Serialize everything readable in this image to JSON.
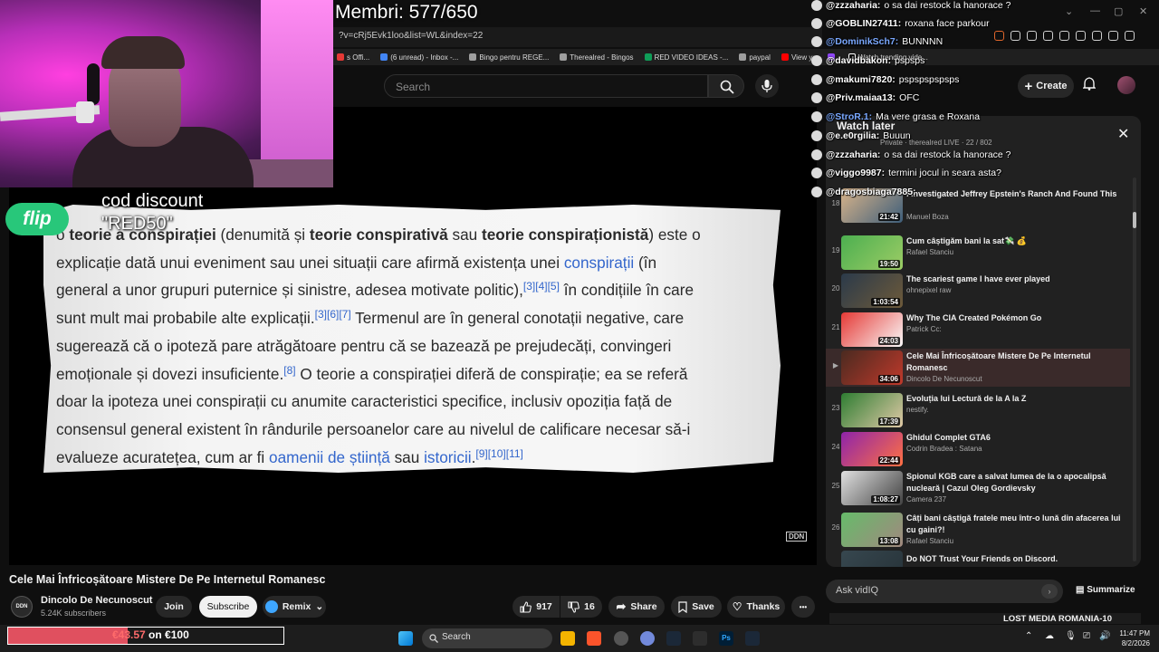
{
  "stream": {
    "membri": "Membri: 577/650",
    "promo": "cod discount\n\"RED50\"",
    "flip": "flip",
    "hype_current": "€43.57",
    "hype_goal": "on €100",
    "hype_fraction": 0.4357
  },
  "browser": {
    "url": "?v=cRj5Evk1loo&list=WL&index=22",
    "bookmarks": [
      "s Offi...",
      "(6 unread) - Inbox -...",
      "Bingo pentru REGE...",
      "Therealred - Bingos",
      "RED VIDEO IDEAS -...",
      "paypal",
      "View yo",
      "",
      "Watch trending vide..."
    ]
  },
  "youtube": {
    "search_placeholder": "Search",
    "create_label": "Create",
    "video_title": "Cele Mai Înfricoșătoare Mistere De Pe Internetul Romanesc",
    "channel_name": "Dincolo De Necunoscut",
    "channel_subs": "5.24K subscribers",
    "channel_avatar": "DDN",
    "join_label": "Join",
    "subscribe_label": "Subscribe",
    "remix_label": "Remix",
    "likes": "917",
    "dislikes": "16",
    "share_label": "Share",
    "save_label": "Save",
    "thanks_label": "Thanks",
    "more_label": "•••",
    "watermark": "DDN"
  },
  "wiki": {
    "l1_a": "o ",
    "l1_b": "teorie a conspirației",
    "l1_c": " (denumită și ",
    "l1_d": "teorie conspirativă",
    "l1_e": " sau ",
    "l1_f": "teorie conspiraționistă",
    "l1_g": ") este o",
    "l2_a": "explicație dată unui eveniment sau unei situații care afirmă existența unei ",
    "l2_b": "conspirații",
    "l2_c": " (în",
    "l3_a": "general a unor grupuri puternice și sinistre, adesea motivate politic),",
    "l3_sup": "[3][4][5]",
    "l3_b": " în condițiile în care",
    "l4_a": "sunt mult mai probabile alte explicații.",
    "l4_sup": "[3][6][7]",
    "l4_b": " Termenul are în general conotații negative, care",
    "l5": "sugerează că o ipoteză pare atrăgătoare pentru că se bazează pe prejudecăți, convingeri",
    "l6_a": "emoționale și dovezi insuficiente.",
    "l6_sup": "[8]",
    "l6_b": " O teorie a conspirației diferă de conspirație; ea se referă",
    "l7": "doar la ipoteza unei conspirații cu anumite caracteristici specifice, inclusiv opoziția față de",
    "l8": "consensul general existent în rândurile persoanelor care au nivelul de calificare necesar să-i",
    "l9_a": "evalueze acuratețea, cum ar fi ",
    "l9_b": "oamenii de știință",
    "l9_c": " sau ",
    "l9_d": "istoricii",
    "l9_e": ".",
    "l9_sup": "[9][10][11]"
  },
  "chat": [
    {
      "user": "@zzzaharia:",
      "msg": "o sa dai restock la hanorace ?",
      "hl": false
    },
    {
      "user": "@GOBLIN27411:",
      "msg": "roxana face parkour",
      "hl": false
    },
    {
      "user": "@DominikSch7:",
      "msg": "BUNNNN",
      "hl": true
    },
    {
      "user": "@davidbakon:",
      "msg": "pspsps",
      "hl": false
    },
    {
      "user": "@makumi7820:",
      "msg": "pspspspspsps",
      "hl": false
    },
    {
      "user": "@Priv.maiaa13:",
      "msg": "OFC",
      "hl": false
    },
    {
      "user": "@StroR.1:",
      "msg": "Ma vere grasa e Roxana",
      "hl": true
    },
    {
      "user": "@e.e0rgilia:",
      "msg": "Buuun",
      "hl": false
    },
    {
      "user": "@zzzaharia:",
      "msg": "o sa dai restock la hanorace ?",
      "hl": false
    },
    {
      "user": "@viggo9987:",
      "msg": "termini jocul in seara asta?",
      "hl": false
    },
    {
      "user": "@dragosbiaga7885:",
      "msg": "",
      "hl": false
    }
  ],
  "watch_later": {
    "title": "Watch later",
    "subtitle": "Private · therealred LIVE · 22 / 802",
    "close": "✕",
    "items": [
      {
        "num": "18",
        "title": "I Investigated Jeffrey Epstein's Ranch And Found This",
        "channel": "Manuel Boza",
        "duration": "21:42",
        "active": false,
        "c1": "#d9b48a",
        "c2": "#3e5e7a"
      },
      {
        "num": "19",
        "title": "Cum câștigăm bani la sat💸 💰",
        "channel": "Rafael Stanciu",
        "duration": "19:50",
        "active": false,
        "c1": "#4caf50",
        "c2": "#9ccc65"
      },
      {
        "num": "20",
        "title": "The scariest game I have ever played",
        "channel": "ohnepixel raw",
        "duration": "1:03:54",
        "active": false,
        "c1": "#2b3a4a",
        "c2": "#6d5a3a"
      },
      {
        "num": "21",
        "title": "Why The CIA Created Pokémon Go",
        "channel": "Patrick Cc:",
        "duration": "24:03",
        "active": false,
        "c1": "#e53935",
        "c2": "#fafafa"
      },
      {
        "num": "▶",
        "title": "Cele Mai Înfricoșătoare Mistere De Pe Internetul Romanesc",
        "channel": "Dincolo De Necunoscut",
        "duration": "34:06",
        "active": true,
        "c1": "#4a2a20",
        "c2": "#c0392b"
      },
      {
        "num": "23",
        "title": "Evoluția lui Lectură de la A la Z",
        "channel": "nestify.",
        "duration": "17:39",
        "active": false,
        "c1": "#2e7d32",
        "c2": "#e0c9a6"
      },
      {
        "num": "24",
        "title": "Ghidul Complet GTA6",
        "channel": "Codrin Bradea : Satana",
        "duration": "22:44",
        "active": false,
        "c1": "#8e24aa",
        "c2": "#ff7043"
      },
      {
        "num": "25",
        "title": "Spionul KGB care a salvat lumea de la o apocalipsă nucleară | Cazul Oleg Gordievsky",
        "channel": "Camera 237",
        "duration": "1:08:27",
        "active": false,
        "c1": "#e0e0e0",
        "c2": "#424242"
      },
      {
        "num": "26",
        "title": "Câți bani câștigă fratele meu într-o lună din afacerea lui cu gaini?!",
        "channel": "Rafael Stanciu",
        "duration": "13:08",
        "active": false,
        "c1": "#66bb6a",
        "c2": "#a1887f"
      },
      {
        "num": "",
        "title": "Do NOT Trust Your Friends on Discord.",
        "channel": "",
        "duration": "",
        "active": false,
        "c1": "#37474f",
        "c2": "#263238"
      }
    ]
  },
  "vidiq": {
    "ask_placeholder": "Ask vidIQ",
    "summarize": "Summarize",
    "lost_media": "LOST MEDIA ROMANIA-10"
  },
  "taskbar": {
    "search_label": "Search",
    "time": "11:47 PM",
    "date": "8/2/2026"
  }
}
